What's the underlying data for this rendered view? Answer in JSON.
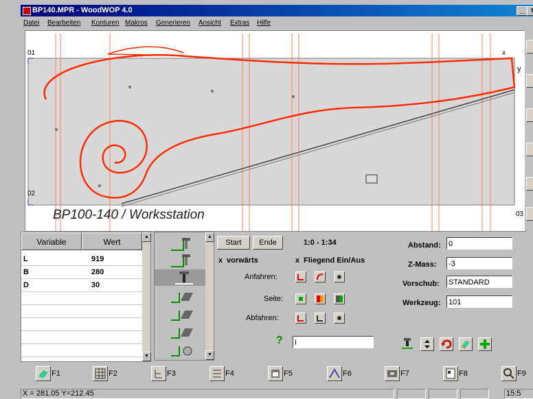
{
  "window": {
    "title": "BP140.MPR - WoodWOP 4.0",
    "minimize": "_",
    "restore": "т"
  },
  "menu": [
    "Datei",
    "Bearbeiten",
    "Konturen",
    "Makros",
    "Generieren",
    "Ansicht",
    "Extras",
    "Hilfe"
  ],
  "canvas": {
    "caption": "BP100-140 / Worksstation",
    "corner_tl": "01",
    "corner_bl": "02",
    "corner_br": "03",
    "axis_y": "y",
    "marker_x": "x",
    "contour_color": "#ff2a00",
    "guide_color": "#ff7755"
  },
  "variables": {
    "col_variable": "Variable",
    "col_wert": "Wert",
    "rows": [
      {
        "name": "L",
        "value": "919"
      },
      {
        "name": "B",
        "value": "280"
      },
      {
        "name": "D",
        "value": "30"
      }
    ]
  },
  "params": {
    "start_label": "Start",
    "ende_label": "Ende",
    "range": "1:0 - 1:34",
    "vorwaerts_mark": "x",
    "vorwaerts": "vorwärts",
    "fliegend_mark": "x",
    "fliegend": "Fliegend Ein/Aus",
    "anfahren": "Anfahren:",
    "seite": "Seite:",
    "abfahren": "Abfahren:",
    "abstand_label": "Abstand:",
    "abstand_value": "0",
    "zmass_label": "Z-Mass:",
    "zmass_value": "-3",
    "vorschub_label": "Vorschub:",
    "vorschub_value": "STANDARD",
    "werkzeug_label": "Werkzeug:",
    "werkzeug_value": "101",
    "help_glyph": "?",
    "command_value": "I"
  },
  "fkeys": [
    "F1",
    "F2",
    "F3",
    "F4",
    "F5",
    "F6",
    "F7",
    "F8",
    "F9"
  ],
  "status": {
    "coords": "X = 281.05   Y=212.45",
    "time": "15:5"
  }
}
